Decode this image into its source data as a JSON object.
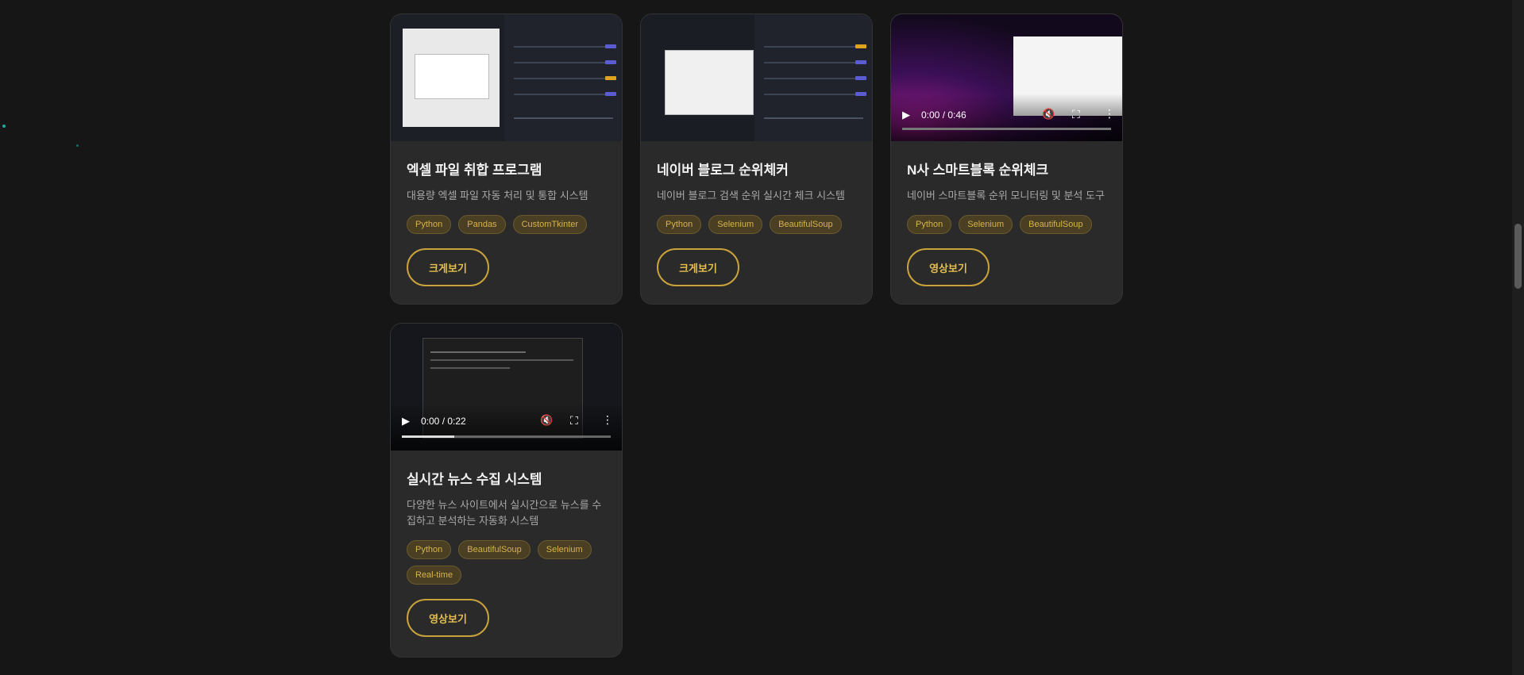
{
  "projects": [
    {
      "title": "엑셀 파일 취합 프로그램",
      "description": "대용량 엑셀 파일 자동 처리 및 통합 시스템",
      "tags": [
        "Python",
        "Pandas",
        "CustomTkinter"
      ],
      "button": "크게보기",
      "media": "image"
    },
    {
      "title": "네이버 블로그 순위체커",
      "description": "네이버 블로그 검색 순위 실시간 체크 시스템",
      "tags": [
        "Python",
        "Selenium",
        "BeautifulSoup"
      ],
      "button": "크게보기",
      "media": "image"
    },
    {
      "title": "N사 스마트블록 순위체크",
      "description": "네이버 스마트블록 순위 모니터링 및 분석 도구",
      "tags": [
        "Python",
        "Selenium",
        "BeautifulSoup"
      ],
      "button": "영상보기",
      "media": "video",
      "video_time": "0:00 / 0:46",
      "video_progress": 0
    },
    {
      "title": "실시간 뉴스 수집 시스템",
      "description": "다양한 뉴스 사이트에서 실시간으로 뉴스를 수집하고 분석하는 자동화 시스템",
      "tags": [
        "Python",
        "BeautifulSoup",
        "Selenium",
        "Real-time"
      ],
      "button": "영상보기",
      "media": "video",
      "video_time": "0:00 / 0:22",
      "video_progress": 0.25
    }
  ],
  "colors": {
    "page_bg": "#161616",
    "card_bg": "#2a2a2a",
    "accent": "#c9a23a",
    "tag_bg": "#4a3f22"
  },
  "icons": [
    "play-icon",
    "mute-icon",
    "fullscreen-icon",
    "more-vertical-icon"
  ]
}
